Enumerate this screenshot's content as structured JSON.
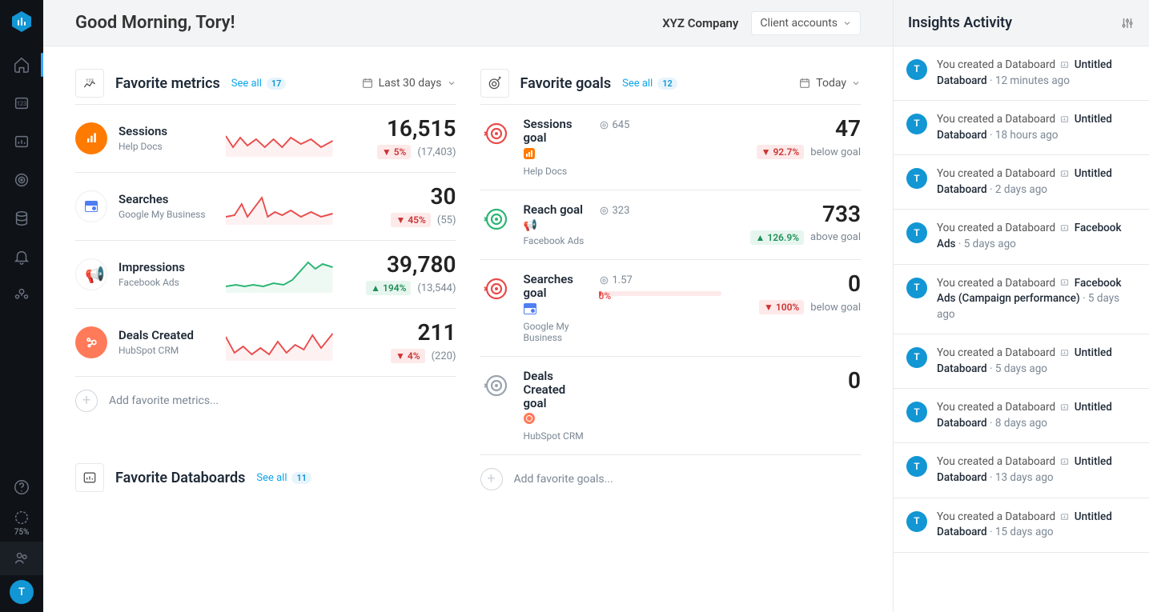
{
  "header": {
    "greeting": "Good Morning, Tory!",
    "company": "XYZ Company",
    "accounts_dropdown": "Client accounts"
  },
  "metrics_section": {
    "title": "Favorite metrics",
    "see_all": "See all",
    "count": "17",
    "timeframe": "Last 30 days",
    "add_label": "Add favorite metrics..."
  },
  "metrics": [
    {
      "title": "Sessions",
      "source": "Help Docs",
      "value": "16,515",
      "delta_dir": "down",
      "delta_text": "5%",
      "paren": "(17,403)",
      "color": "red",
      "icon_bg": "#ff7a00",
      "icon_kind": "ga"
    },
    {
      "title": "Searches",
      "source": "Google My Business",
      "value": "30",
      "delta_dir": "down",
      "delta_text": "45%",
      "paren": "(55)",
      "color": "red",
      "icon_bg": "#ffffff",
      "icon_kind": "gmb"
    },
    {
      "title": "Impressions",
      "source": "Facebook Ads",
      "value": "39,780",
      "delta_dir": "up",
      "delta_text": "194%",
      "paren": "(13,544)",
      "color": "green",
      "icon_bg": "#ffffff",
      "icon_kind": "fb"
    },
    {
      "title": "Deals Created",
      "source": "HubSpot CRM",
      "value": "211",
      "delta_dir": "down",
      "delta_text": "4%",
      "paren": "(220)",
      "color": "red",
      "icon_bg": "#ff7a59",
      "icon_kind": "hs"
    }
  ],
  "goals_section": {
    "title": "Favorite goals",
    "see_all": "See all",
    "count": "12",
    "timeframe": "Today",
    "add_label": "Add favorite goals..."
  },
  "goals": [
    {
      "title": "Sessions goal",
      "source": "Help Docs",
      "target": "645",
      "value": "47",
      "delta_dir": "down",
      "delta_text": "92.7%",
      "status": "below goal",
      "icon_color": "#e94b4b",
      "src_icon": "ga"
    },
    {
      "title": "Reach goal",
      "source": "Facebook Ads",
      "target": "323",
      "value": "733",
      "delta_dir": "up",
      "delta_text": "126.9%",
      "status": "above goal",
      "icon_color": "#2bb673",
      "src_icon": "fb"
    },
    {
      "title": "Searches goal",
      "source": "Google My Business",
      "target": "1.57",
      "value": "0",
      "delta_dir": "down",
      "delta_text": "100%",
      "status": "below goal",
      "icon_color": "#e94b4b",
      "src_icon": "gmb",
      "progress_pct_label": "0%"
    },
    {
      "title": "Deals Created goal",
      "source": "HubSpot CRM",
      "target": "",
      "value": "0",
      "delta_dir": "",
      "delta_text": "",
      "status": "",
      "icon_color": "#9aa4af",
      "src_icon": "hs"
    }
  ],
  "databoards_section": {
    "title": "Favorite Databoards",
    "see_all": "See all",
    "count": "11"
  },
  "insights": {
    "title": "Insights Activity",
    "action_text": "You created a Databoard",
    "items": [
      {
        "object": "Untitled Databoard",
        "when": "12 minutes ago"
      },
      {
        "object": "Untitled Databoard",
        "when": "18 hours ago"
      },
      {
        "object": "Untitled Databoard",
        "when": "2 days ago"
      },
      {
        "object": "Facebook Ads",
        "when": "5 days ago"
      },
      {
        "object": "Facebook Ads (Campaign performance)",
        "when": "5 days ago"
      },
      {
        "object": "Untitled Databoard",
        "when": "5 days ago"
      },
      {
        "object": "Untitled Databoard",
        "when": "8 days ago"
      },
      {
        "object": "Untitled Databoard",
        "when": "13 days ago"
      },
      {
        "object": "Untitled Databoard",
        "when": "15 days ago"
      }
    ]
  },
  "sidebar": {
    "usage": "75%",
    "avatar": "T"
  }
}
